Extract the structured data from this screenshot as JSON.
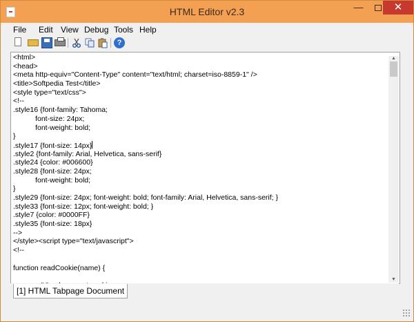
{
  "window": {
    "title": "HTML Editor v2.3",
    "close_glyph": "✕",
    "minimize_glyph": "—"
  },
  "menu": {
    "items": [
      "File",
      "Edit",
      "View",
      "Debug",
      "Tools",
      "Help"
    ]
  },
  "toolbar": {
    "buttons": [
      "new-file-icon",
      "open-folder-icon",
      "save-icon",
      "print-icon",
      "cut-icon",
      "copy-icon",
      "paste-icon",
      "help-icon"
    ],
    "help_glyph": "?"
  },
  "editor": {
    "lines": [
      "<html>",
      "<head>",
      "<meta http-equiv=\"Content-Type\" content=\"text/html; charset=iso-8859-1\" />",
      "<title>Softpedia Test</title>",
      "<style type=\"text/css\">",
      "<!--",
      ".style16 {font-family: Tahoma;",
      "           font-size: 24px;",
      "           font-weight: bold;",
      "}",
      ".style17 {font-size: 14px}",
      ".style2 {font-family: Arial, Helvetica, sans-serif}",
      ".style24 {color: #006600}",
      ".style28 {font-size: 24px;",
      "           font-weight: bold;",
      "}",
      ".style29 {font-size: 24px; font-weight: bold; font-family: Arial, Helvetica, sans-serif; }",
      ".style33 {font-size: 12px; font-weight: bold; }",
      ".style7 {color: #0000FF}",
      ".style35 {font-size: 18px}",
      "-->",
      "</style><script type=\"text/javascript\">",
      "<!--",
      "",
      "function readCookie(name) {",
      "",
      "  var c = \" \" + document.cookie;"
    ],
    "caret_line": 10
  },
  "tabs": [
    {
      "label": "[1] HTML Tabpage Document"
    }
  ],
  "colors": {
    "titlebar": "#f3a052",
    "close_button": "#c7392f"
  }
}
